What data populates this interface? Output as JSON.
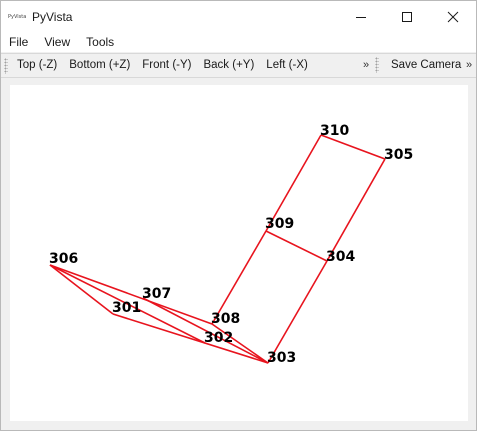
{
  "window": {
    "app_icon_text": "PyVista",
    "title": "PyVista"
  },
  "menu": {
    "items": [
      "File",
      "View",
      "Tools"
    ]
  },
  "toolbar": {
    "views": [
      "Top (-Z)",
      "Bottom (+Z)",
      "Front (-Y)",
      "Back (+Y)",
      "Left (-X)"
    ],
    "overflow": "»",
    "save_camera": "Save Camera",
    "overflow2": "»"
  },
  "plot": {
    "line_color": "#e8141e",
    "labels": [
      "310",
      "305",
      "309",
      "304",
      "306",
      "307",
      "301",
      "308",
      "302",
      "303"
    ]
  }
}
